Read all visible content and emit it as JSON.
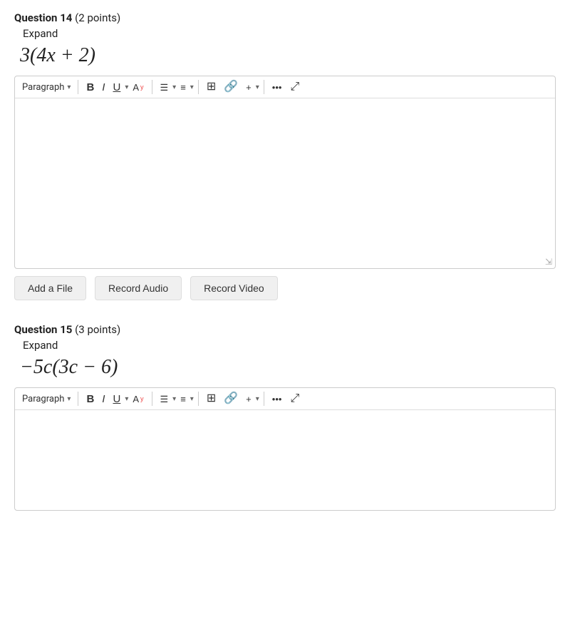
{
  "questions": [
    {
      "id": "q14",
      "number": "Question 14",
      "points": "(2 points)",
      "expand_label": "Expand",
      "math_html": "3(4<i>x</i> + 2)",
      "editor": {
        "paragraph_label": "Paragraph",
        "toolbar_buttons": [
          "bold",
          "italic",
          "underline",
          "text-color",
          "align",
          "list",
          "insert",
          "link",
          "plus",
          "more",
          "fullscreen"
        ],
        "placeholder": ""
      },
      "action_buttons": [
        "Add a File",
        "Record Audio",
        "Record Video"
      ]
    },
    {
      "id": "q15",
      "number": "Question 15",
      "points": "(3 points)",
      "expand_label": "Expand",
      "math_html": "&#x2212;5<i>c</i>(3<i>c</i> &#x2212; 6)",
      "editor": {
        "paragraph_label": "Paragraph",
        "toolbar_buttons": [
          "bold",
          "italic",
          "underline",
          "text-color",
          "align",
          "list",
          "insert",
          "link",
          "plus",
          "more",
          "fullscreen"
        ],
        "placeholder": ""
      },
      "action_buttons": []
    }
  ],
  "labels": {
    "add_file": "Add a File",
    "record_audio": "Record Audio",
    "record_video": "Record Video",
    "paragraph": "Paragraph",
    "bold": "B",
    "italic": "I",
    "underline": "U",
    "expand": "Expand"
  }
}
